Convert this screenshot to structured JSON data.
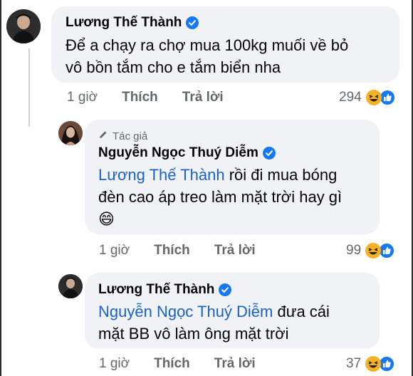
{
  "comments": [
    {
      "author": "Lương Thế Thành",
      "verified": true,
      "text_lines": [
        "Để a chạy ra chợ mua 100kg muối về bỏ",
        "vô bồn tắm cho e tắm biển nha"
      ],
      "time": "1 giờ",
      "like_label": "Thích",
      "reply_label": "Trả lời",
      "reaction_count": "294",
      "reactions": [
        "haha-icon",
        "like-icon"
      ]
    },
    {
      "author_tag": "Tác giả",
      "author": "Nguyễn Ngọc Thuý Diễm",
      "verified": true,
      "mention": "Lương Thế Thành",
      "text_line1_rest": " rồi đi mua bóng",
      "text_line2": "đèn cao áp treo làm mặt trời hay gì",
      "emoji": "😄",
      "time": "1 giờ",
      "like_label": "Thích",
      "reply_label": "Trả lời",
      "reaction_count": "99",
      "reactions": [
        "haha-icon",
        "like-icon"
      ]
    },
    {
      "author": "Lương Thế Thành",
      "verified": true,
      "mention": "Nguyễn Ngọc Thuý Diễm",
      "text_line1_rest": " đưa cái",
      "text_line2": "mặt BB vô làm ông mặt trời",
      "time": "1 giờ",
      "like_label": "Thích",
      "reply_label": "Trả lời",
      "reaction_count": "37",
      "reactions": [
        "haha-icon",
        "like-icon"
      ]
    }
  ],
  "colors": {
    "bubble": "#f0f2f5",
    "mention": "#1a62c7",
    "meta": "#65676b",
    "verified": "#1877f2",
    "haha": "#f7b125"
  }
}
